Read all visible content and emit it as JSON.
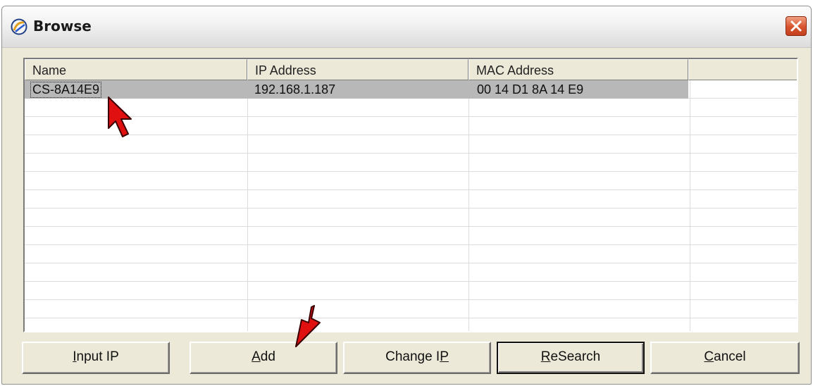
{
  "window": {
    "title": "Browse"
  },
  "list": {
    "columns": [
      "Name",
      "IP Address",
      "MAC Address",
      ""
    ],
    "rows": [
      {
        "name": "CS-8A14E9",
        "ip": "192.168.1.187",
        "mac": "00 14 D1 8A 14 E9",
        "selected": true
      }
    ]
  },
  "buttons": {
    "input_ip": {
      "pre": "",
      "u": "I",
      "post": "nput IP"
    },
    "add": {
      "pre": "",
      "u": "A",
      "post": "dd"
    },
    "change_ip": {
      "pre": "Change I",
      "u": "P",
      "post": ""
    },
    "research": {
      "pre": "",
      "u": "R",
      "post": "eSearch"
    },
    "cancel": {
      "pre": "",
      "u": "C",
      "post": "ancel"
    }
  },
  "colors": {
    "selection": "#b8b8b8",
    "annotation_arrow": "#e01010",
    "close_button": "#d8542e"
  }
}
